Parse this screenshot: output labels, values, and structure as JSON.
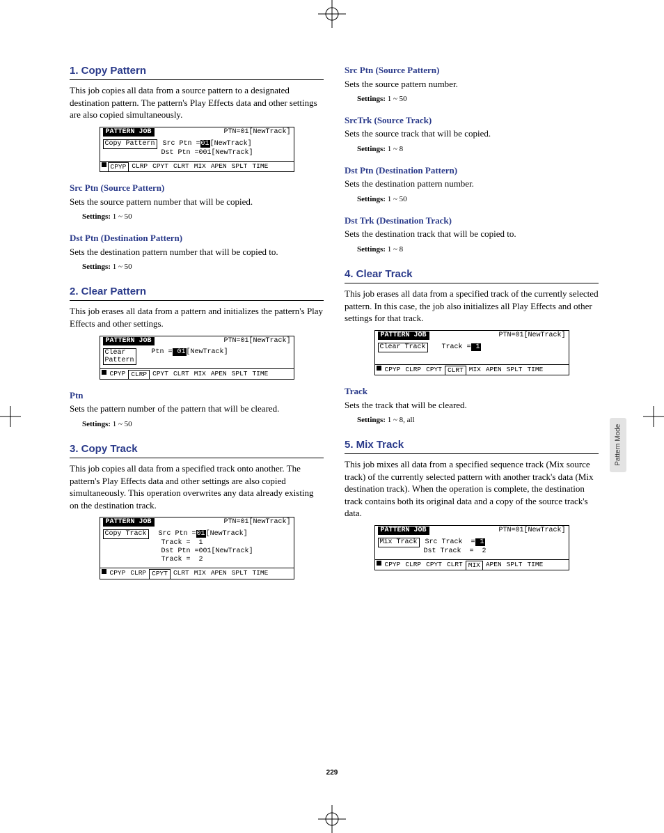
{
  "page_number": "229",
  "side_tab": "Pattern Mode",
  "left": {
    "s1": {
      "title": "1. Copy Pattern",
      "body": "This job copies all data from a source pattern to a designated destination pattern. The pattern's Play Effects data and other settings are also copied simultaneously.",
      "screen": {
        "header_tab": "PATTERN JOB",
        "header_right": "PTN=01[NewTrack]",
        "box": "Copy Pattern",
        "l1a": "Src Ptn =",
        "l1b": "01",
        "l1c": "[NewTrack]",
        "l2": "Dst Ptn =001[NewTrack]",
        "footer": [
          "CPYP",
          "CLRP",
          "CPYT",
          "CLRT",
          "MIX",
          "APEN",
          "SPLT",
          "TIME"
        ],
        "sel": 0
      },
      "p1": {
        "title": "Src Ptn (Source Pattern)",
        "desc": "Sets the source pattern number that will be copied.",
        "settings": "1 ~ 50"
      },
      "p2": {
        "title": "Dst Ptn (Destination Pattern)",
        "desc": "Sets the destination pattern number that will be copied to.",
        "settings": "1 ~ 50"
      }
    },
    "s2": {
      "title": "2. Clear Pattern",
      "body": "This job erases all data from a pattern and initializes the pattern's Play Effects and other settings.",
      "screen": {
        "header_tab": "PATTERN JOB",
        "header_right": "PTN=01[NewTrack]",
        "box1": "Clear",
        "box2": "Pattern",
        "l1a": "Ptn =",
        "l1b": " 01",
        "l1c": "[NewTrack]",
        "footer": [
          "CPYP",
          "CLRP",
          "CPYT",
          "CLRT",
          "MIX",
          "APEN",
          "SPLT",
          "TIME"
        ],
        "sel": 1
      },
      "p1": {
        "title": "Ptn",
        "desc": "Sets the pattern number of the pattern that will be cleared.",
        "settings": "1 ~ 50"
      }
    },
    "s3": {
      "title": "3. Copy Track",
      "body": "This job copies all data from a specified track onto another. The pattern's Play Effects data and other settings are also copied simultaneously. This operation overwrites any data already existing on the destination track.",
      "screen": {
        "header_tab": "PATTERN JOB",
        "header_right": "PTN=01[NewTrack]",
        "box": "Copy Track",
        "l1a": "Src Ptn =",
        "l1b": "01",
        "l1c": "[NewTrack]",
        "l2": "    Track =  1",
        "l3": "Dst Ptn =001[NewTrack]",
        "l4": "    Track =  2",
        "footer": [
          "CPYP",
          "CLRP",
          "CPYT",
          "CLRT",
          "MIX",
          "APEN",
          "SPLT",
          "TIME"
        ],
        "sel": 2
      }
    }
  },
  "right": {
    "p1": {
      "title": "Src Ptn (Source Pattern)",
      "desc": "Sets the source pattern number.",
      "settings": "1 ~ 50"
    },
    "p2": {
      "title": "SrcTrk (Source Track)",
      "desc": "Sets the source track that will be copied.",
      "settings": "1 ~ 8"
    },
    "p3": {
      "title": "Dst Ptn (Destination Pattern)",
      "desc": "Sets the destination pattern number.",
      "settings": "1 ~ 50"
    },
    "p4": {
      "title": "Dst Trk (Destination Track)",
      "desc": "Sets the destination track that will be copied to.",
      "settings": "1 ~ 8"
    },
    "s4": {
      "title": "4. Clear Track",
      "body": "This job erases all data from a specified track of the currently selected pattern. In this case, the job also initializes all Play Effects and other settings for that track.",
      "screen": {
        "header_tab": "PATTERN JOB",
        "header_right": "PTN=01[NewTrack]",
        "box": "Clear Track",
        "l1a": "Track =",
        "l1b": " 1",
        "footer": [
          "CPYP",
          "CLRP",
          "CPYT",
          "CLRT",
          "MIX",
          "APEN",
          "SPLT",
          "TIME"
        ],
        "sel": 3
      },
      "p1": {
        "title": "Track",
        "desc": "Sets the track that will be cleared.",
        "settings": "1 ~ 8, all"
      }
    },
    "s5": {
      "title": "5. Mix Track",
      "body": "This job mixes all data from a specified sequence track (Mix source track) of the currently selected pattern with another track's data (Mix destination track). When the operation is complete, the destination track contains both its original data and a copy of the source track's data.",
      "screen": {
        "header_tab": "PATTERN JOB",
        "header_right": "PTN=01[NewTrack]",
        "box": "Mix Track",
        "l1a": "Src Track  =",
        "l1b": " 1",
        "l2": "Dst Track  =  2",
        "footer": [
          "CPYP",
          "CLRP",
          "CPYT",
          "CLRT",
          "MIX",
          "APEN",
          "SPLT",
          "TIME"
        ],
        "sel": 4
      }
    }
  },
  "settings_label": "Settings:"
}
